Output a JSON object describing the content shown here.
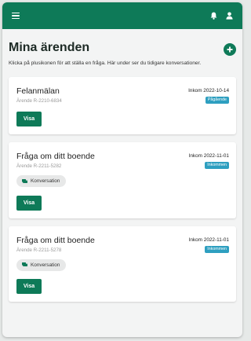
{
  "header": {
    "title": "Mina ärenden",
    "description": "Klicka på plusikonen för att ställa en fråga. Här under ser du tidigare konversationer.",
    "add_icon": "plus-circle-icon"
  },
  "topbar": {
    "color": "#0e7a58",
    "icons": [
      "menu-icon",
      "bell-icon",
      "user-icon"
    ]
  },
  "cases": [
    {
      "title": "Felanmälan",
      "case_id": "Ärende R-2210-6834",
      "date": "Inkom 2022-10-14",
      "status": "Pågående",
      "chip": "",
      "button": "Visa"
    },
    {
      "title": "Fråga om ditt boende",
      "case_id": "Ärende R-2211-5282",
      "date": "Inkom 2022-11-01",
      "status": "Inkommen",
      "chip": "Konversation",
      "button": "Visa"
    },
    {
      "title": "Fråga om ditt boende",
      "case_id": "Ärende R-2211-5278",
      "date": "Inkom 2022-11-01",
      "status": "Inkommen",
      "chip": "Konversation",
      "button": "Visa"
    }
  ],
  "colors": {
    "accent": "#0e7a58",
    "status_badge": "#2e9fc0"
  }
}
